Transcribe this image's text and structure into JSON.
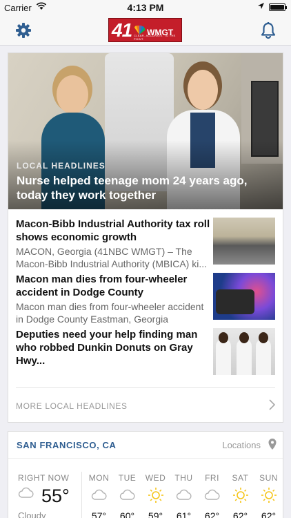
{
  "status_bar": {
    "carrier": "Carrier",
    "time": "4:13 PM",
    "battery_level": 1.0
  },
  "nav": {
    "logo_number": "41",
    "logo_call": "WMGT",
    "logo_tagline": "CLEAR. ACCURATE. TO THE POINT."
  },
  "hero": {
    "kicker": "LOCAL HEADLINES",
    "headline": "Nurse helped teenage mom 24 years ago, today they work together"
  },
  "stories": [
    {
      "title": "Macon-Bibb Industrial Authority tax roll shows economic growth",
      "summary": "MACON, Georgia (41NBC WMGT) – The Macon-Bibb Industrial Authority (MBICA) ki..."
    },
    {
      "title": "Macon man dies from four-wheeler accident in Dodge County",
      "summary": "Macon man dies from four-wheeler accident in Dodge County Eastman, Georgia (41NBC..."
    },
    {
      "title": "Deputies need your help finding man who robbed Dunkin Donuts on Gray Hwy...",
      "summary": ""
    }
  ],
  "more_link": "MORE LOCAL HEADLINES",
  "weather": {
    "city": "SAN FRANCISCO, CA",
    "locations_label": "Locations",
    "now": {
      "label": "RIGHT NOW",
      "temp": "55°",
      "condition": "Cloudy",
      "icon": "cloud-icon"
    },
    "days": [
      {
        "name": "MON",
        "temp": "57°",
        "icon": "cloud-icon"
      },
      {
        "name": "TUE",
        "temp": "60°",
        "icon": "cloud-icon"
      },
      {
        "name": "WED",
        "temp": "59°",
        "icon": "sun-icon"
      },
      {
        "name": "THU",
        "temp": "61°",
        "icon": "cloud-icon"
      },
      {
        "name": "FRI",
        "temp": "62°",
        "icon": "cloud-icon"
      },
      {
        "name": "SAT",
        "temp": "62°",
        "icon": "sun-icon"
      },
      {
        "name": "SUN",
        "temp": "62°",
        "icon": "sun-icon"
      }
    ]
  },
  "colors": {
    "accent": "#2f5e91",
    "brand_red": "#c41e2a",
    "sun": "#f5c518"
  }
}
